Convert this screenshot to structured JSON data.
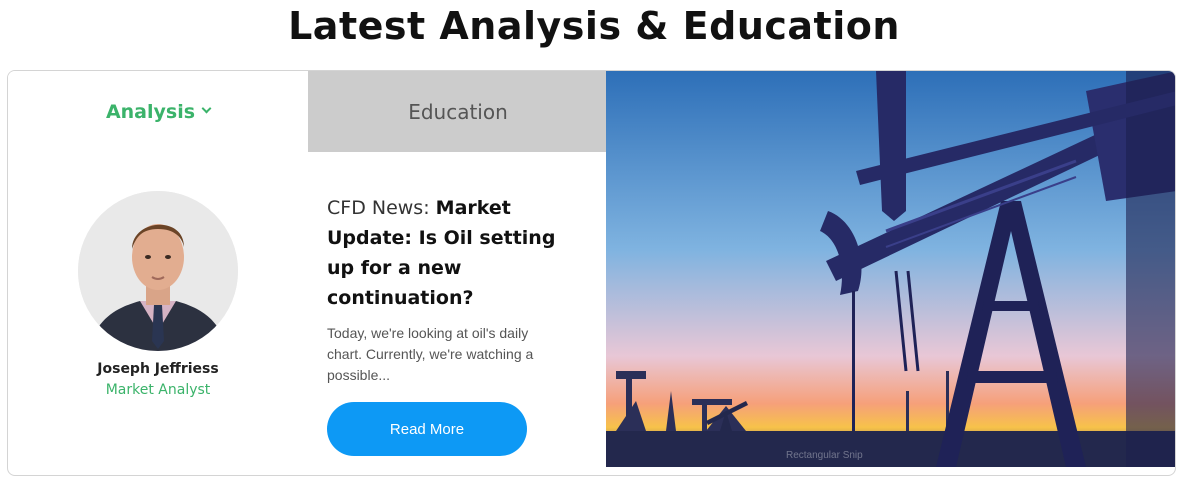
{
  "page": {
    "title": "Latest Analysis & Education"
  },
  "tabs": [
    {
      "label": "Analysis",
      "active": true,
      "icon": "chevron-down-icon"
    },
    {
      "label": "Education",
      "active": false
    }
  ],
  "author": {
    "name": "Joseph Jeffriess",
    "role": "Market Analyst"
  },
  "article": {
    "prefix": "CFD News: ",
    "headline": "Market Update: Is Oil setting up for a new continuation?",
    "excerpt": "Today, we're looking at oil's daily chart. Currently, we're watching a possible...",
    "cta": "Read More"
  },
  "hero": {
    "caption": "Rectangular Snip"
  },
  "colors": {
    "accent_green": "#3bb36a",
    "button_blue": "#0d99f5",
    "inactive_tab": "#cccccc"
  }
}
